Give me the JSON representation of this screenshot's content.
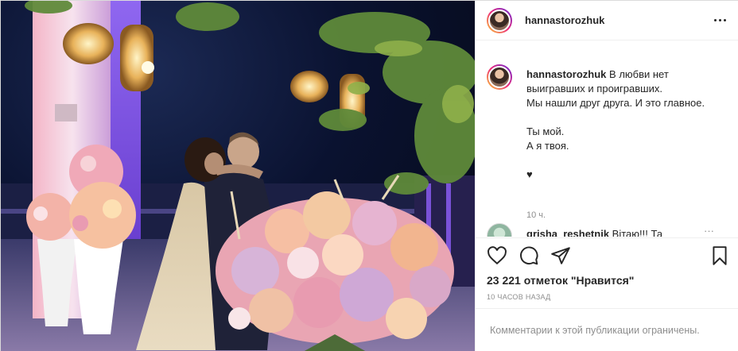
{
  "post": {
    "author": {
      "username": "hannastorozhuk",
      "avatar_icon": "profile-avatar"
    },
    "header": {
      "more_icon": "more-horizontal-icon"
    },
    "caption": {
      "username": "hannastorozhuk",
      "first_line": "В любви нет",
      "lines": [
        "выигравших и проигравших.",
        "Мы нашли друг друга. И это главное."
      ],
      "lines2": [
        "Ты мой.",
        "А я твоя."
      ],
      "heart": "♥",
      "time": "10 ч."
    },
    "comment": {
      "username": "grisha_reshetnik",
      "text": "Вітаю!!! Та",
      "more": "···"
    },
    "actions": {
      "like_icon": "heart-icon",
      "comment_icon": "comment-icon",
      "share_icon": "share-icon",
      "save_icon": "bookmark-icon"
    },
    "likes": "23 221 отметок \"Нравится\"",
    "posted_ago": "10 ЧАСОВ НАЗАД",
    "comments_disabled": "Комментарии к этой публикации ограничены."
  }
}
